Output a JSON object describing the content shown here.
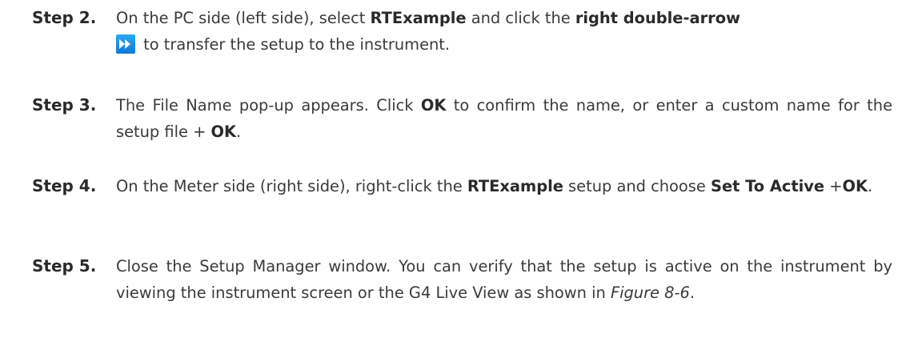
{
  "steps": [
    {
      "label": "Step 2.",
      "t1": "On the PC side (left side), select ",
      "b1": "RTExample",
      "t2": " and click the ",
      "b2": "right double-arrow",
      "icon": "fast-forward-icon",
      "t3": " to transfer the setup to the instrument."
    },
    {
      "label": "Step 3.",
      "t1": "The File Name pop-up appears. Click ",
      "b1": "OK",
      "t2": " to confirm the name, or enter a custom name for the setup file + ",
      "b2": "OK",
      "t3": "."
    },
    {
      "label": "Step 4.",
      "t1": "On the Meter side (right side), right-click the ",
      "b1": "RTExample",
      "t2": " setup and choose ",
      "b2": "Set To Active",
      "t3": " +",
      "b3": "OK",
      "t4": "."
    },
    {
      "label": "Step 5.",
      "t1": "Close the Setup Manager window. You can verify that the setup is active on the instrument by viewing the instrument screen or the G4 Live View as shown in ",
      "i1": "Figure 8-6",
      "t2": "."
    }
  ],
  "colors": {
    "text": "#3a3a3a",
    "icon_blue": "#1e90e6"
  }
}
